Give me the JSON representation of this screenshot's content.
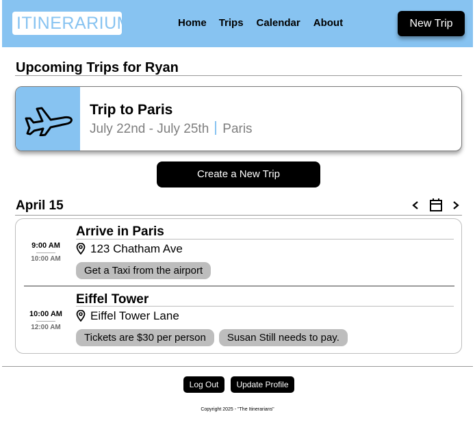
{
  "header": {
    "logo_text": "ITINERARIUM",
    "nav": [
      "Home",
      "Trips",
      "Calendar",
      "About"
    ],
    "new_trip_label": "New Trip"
  },
  "upcoming": {
    "title": "Upcoming Trips for Ryan",
    "trips": [
      {
        "title": "Trip to Paris",
        "dates": "July 22nd - July 25th",
        "location": "Paris",
        "icon": "airplane-icon"
      }
    ]
  },
  "create_trip_label": "Create a New Trip",
  "schedule": {
    "date": "April 15",
    "events": [
      {
        "start": "9:00 AM",
        "end": "10:00 AM",
        "title": "Arrive in Paris",
        "location": "123 Chatham Ave",
        "notes": [
          "Get a Taxi from the airport"
        ]
      },
      {
        "start": "10:00 AM",
        "end": "12:00 AM",
        "title": "Eiffel Tower",
        "location": "Eiffel Tower Lane",
        "notes": [
          "Tickets are $30 per person",
          "Susan Still needs to pay."
        ]
      }
    ]
  },
  "footer": {
    "logout_label": "Log Out",
    "update_profile_label": "Update Profile",
    "copyright": "Copyright 2025 - \"The Itinerarians\""
  },
  "colors": {
    "accent": "#87c3f1",
    "button": "#000000",
    "tag": "#bdbdbd",
    "muted_text": "#7e7e7e"
  }
}
